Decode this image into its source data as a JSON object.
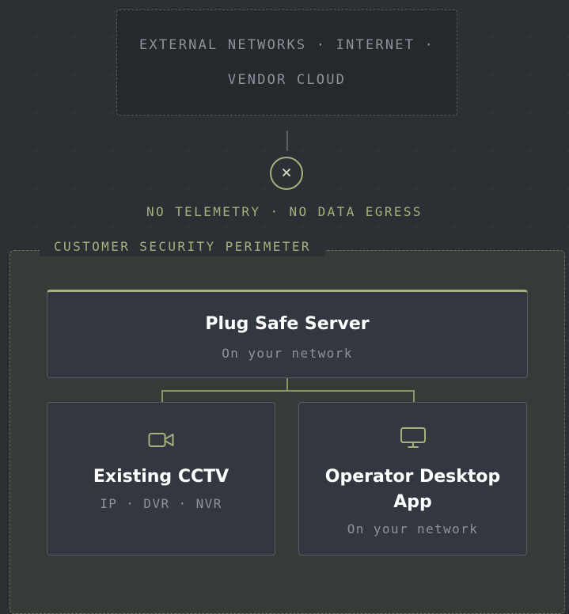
{
  "external": {
    "label": "EXTERNAL NETWORKS · INTERNET · VENDOR CLOUD"
  },
  "block": {
    "label": "NO TELEMETRY · NO DATA EGRESS",
    "icon": "x-icon"
  },
  "perimeter": {
    "label": "CUSTOMER SECURITY PERIMETER"
  },
  "server": {
    "title": "Plug Safe Server",
    "subtitle": "On your network"
  },
  "cards": [
    {
      "title": "Existing CCTV",
      "subtitle": "IP · DVR · NVR",
      "icon": "video-camera-icon"
    },
    {
      "title": "Operator Desktop App",
      "subtitle": "On your network",
      "icon": "monitor-icon"
    }
  ],
  "colors": {
    "accent": "#a2b27a",
    "background": "#2c2f34",
    "perimeter_fill": "#363b37",
    "card_fill": "#333840"
  }
}
